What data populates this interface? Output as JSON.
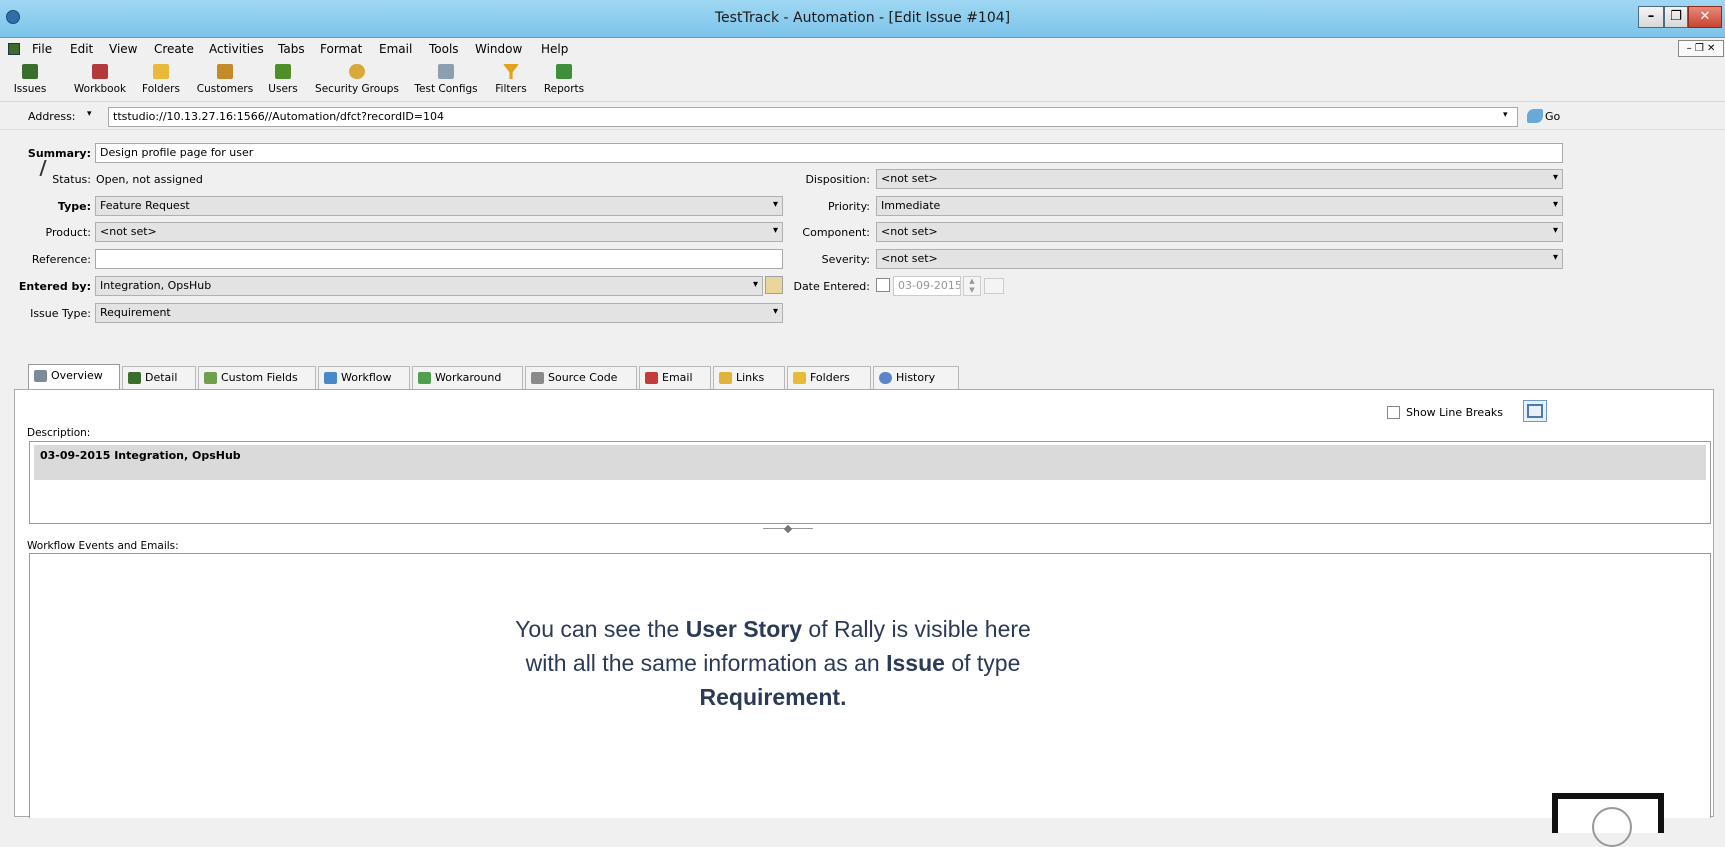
{
  "window": {
    "title": "TestTrack - Automation - [Edit Issue #104]",
    "minimize": "–",
    "restore": "❐",
    "close": "✕"
  },
  "menu": [
    "File",
    "Edit",
    "View",
    "Create",
    "Activities",
    "Tabs",
    "Format",
    "Email",
    "Tools",
    "Window",
    "Help"
  ],
  "toolbar": [
    {
      "label": "Issues",
      "icon": "issues-icon",
      "color": "#3b6e2a"
    },
    {
      "label": "Workbook",
      "icon": "workbook-icon",
      "color": "#b23a3a"
    },
    {
      "label": "Folders",
      "icon": "folder-icon",
      "color": "#e9b93b"
    },
    {
      "label": "Customers",
      "icon": "customers-icon",
      "color": "#c58a2a"
    },
    {
      "label": "Users",
      "icon": "users-icon",
      "color": "#4f8f2a"
    },
    {
      "label": "Security Groups",
      "icon": "shield-icon",
      "color": "#d7a93a"
    },
    {
      "label": "Test Configs",
      "icon": "test-configs-icon",
      "color": "#8aa0b0"
    },
    {
      "label": "Filters",
      "icon": "funnel-icon",
      "color": "#e3a21a"
    },
    {
      "label": "Reports",
      "icon": "reports-icon",
      "color": "#3f8f3a"
    }
  ],
  "address": {
    "label": "Address:",
    "value": "ttstudio://10.13.27.16:1566//Automation/dfct?recordID=104",
    "go_label": "Go"
  },
  "form": {
    "summary_label": "Summary:",
    "summary_value": "Design profile page for user",
    "status_label": "Status:",
    "status_value": "Open, not assigned",
    "type_label": "Type:",
    "type_value": "Feature Request",
    "product_label": "Product:",
    "product_value": "<not set>",
    "reference_label": "Reference:",
    "reference_value": "",
    "entered_by_label": "Entered by:",
    "entered_by_value": "Integration, OpsHub",
    "issue_type_label": "Issue Type:",
    "issue_type_value": "Requirement",
    "disposition_label": "Disposition:",
    "disposition_value": "<not set>",
    "priority_label": "Priority:",
    "priority_value": "Immediate",
    "component_label": "Component:",
    "component_value": "<not set>",
    "severity_label": "Severity:",
    "severity_value": "<not set>",
    "date_entered_label": "Date Entered:",
    "date_entered_value": "03-09-2015"
  },
  "tabs": [
    "Overview",
    "Detail",
    "Custom Fields",
    "Workflow",
    "Workaround",
    "Source Code",
    "Email",
    "Links",
    "Folders",
    "History"
  ],
  "overview": {
    "show_line_breaks": "Show Line Breaks",
    "description_label": "Description:",
    "description_entry": "03-09-2015 Integration, OpsHub",
    "workflow_label": "Workflow Events and Emails:"
  },
  "overlay": {
    "line1_a": "You can see the ",
    "line1_b": "User Story",
    "line1_c": " of Rally is visible here",
    "line2_a": "with all the same information as an ",
    "line2_b": "Issue",
    "line2_c": " of type",
    "line3": "Requirement."
  },
  "colors": {
    "titlebar": "#8fcdee",
    "panel": "#ffffff",
    "overlay_text": "#2b3a55"
  }
}
